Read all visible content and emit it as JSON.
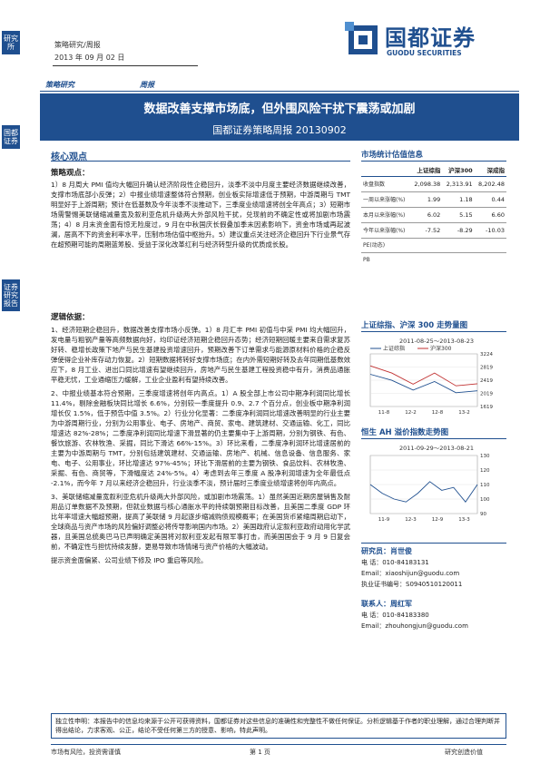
{
  "side": {
    "tab1": "研究所",
    "tab2": "证券研究报告",
    "tab3": "国都证券"
  },
  "header": {
    "line1": "策略研究/周报",
    "line2": "2013 年 09 月 02 日",
    "logo_cn": "国都证券",
    "logo_en": "GUODU SECURITIES"
  },
  "category": {
    "a": "策略研究",
    "b": "周报"
  },
  "title": {
    "main": "数据改善支撑市场底，但外围风险干扰下震荡或加剧",
    "sub": "国都证券策略周报 20130902"
  },
  "core": {
    "heading": "核心观点",
    "view_label": "策略观点：",
    "view_text": "1）8 月周大 PMI 值均大幅回升确认经济阶段性企稳回升，淡季不淡中月度主要经济数据继续改善，支撑市场底部小反弹；2）中报业绩增速整体符合预期，创业板实际增速低于预期，中游周期与 TMT 明显好于上游周期；预计在低基数及今年淡季不淡推动下，三季度业绩增速将创全年高点；3）短期市场需警惕美联储缩减量宽及叙利亚危机升级两大外部风险干扰，兑现前的不确定性或将加剧市场震荡；4）8 月末资金面有惊无险度过，9 月在中秋国庆长假叠加季末因素影响下，资金市场或再起波澜，居高不下的资金利率水平，压制市场估值中枢抬升。5）建议重点关注经济企稳回升下行业景气存在超预期可能的周期蓝筹股、受益于深化改革红利与经济转型升级的优质成长股。",
    "logic_label": "逻辑依据：",
    "p1": "1、经济短期企稳回升，数据改善支撑市场小反弹。1）8 月汇丰 PMI 初值与中采 PMI 均大幅回升，发电量与粗钢产量等高频数据向好，均印证经济短期企稳回升态势；经济短期回暖主要来自需求复苏好转、稳增长政策下地产与民生基建投资增速回升，预期改善下订单需求与能源原材料价格的企稳反弹使得企业补库存动力恢复。2）短期数据将转好支撑市场底；在内外需短期好转及去年同期低基数效应下，8 月工业、进出口同比增速有望继续回升，房地产与民生基建工程投资稳中有升，消费品通胀平稳无忧，工业通缩压力缓解，工业企业盈利有望持续改善。",
    "p2": "2、中报业绩基本符合预期，三季度增速将创年内高点。1）A 股全部上市公司中期净利润同比增长 11.4%，剔除金融板块同比增长 6.6%，分别较一季度提升 0.9、2.7 个百分点，创业板中期净利润增长仅 1.5%，低于预告中值 3.5%。2）行业分化显著：二季度净利润同比增速改善明显的行业主要为中游周期行业，分别为公用事业、电子、房地产、商贸、家电、建筑建材、交通运输、化工，同比增速达 82%-28%；二季度净利润同比增速下滑显著的仍主要集中于上游周期，分别为钢铁、有色、餐饮旅游、农林牧渔、采掘，同比下滑达 66%-15%。3）环比来看，二季度净利润环比增速居前的主要为中游周期与 TMT，分别包括建筑建材、交通运输、房地产、机械、信息设备、信息服务、家电、电子、公用事业，环比增速达 97%-45%；环比下滑居前的主要为钢铁、食品饮料、农林牧渔、采掘、有色、商贸等，下滑幅度达 24%-5%。4）考虑到去年三季度 A 股净利润增速为全年最低点 -2.1%，而今年 7 月以来经济企稳回升，行业淡季不淡，预计届时三季度业绩增速将创年内高点。",
    "p3": "3、美联储缩减量宽叙利亚危机升级两大外部风险，或加剧市场震荡。1）虽然美国近期房屋销售及耐用品订单数据不及预期，但就业数据与核心通胀水平的持续朝预期目标改善，且美国二季度 GDP 环比年率增速大幅超预期，提高了美联储 9 月起逐步缩减购债规模概率；在美国货币紧缩周期启动下，全球商品与资产市场的风险偏好调整必将传导影响国内市场。2）美国政府认定叙利亚政府动用化学武器，且美国总统奥巴马已声明确定美国将对叙利亚发起有限军事打击，而美国国会于 9 月 9 日复会前，不确定性与担忧持续发酵，更易导致市场情绪与资产价格的大幅波动。",
    "p4": "提示资金面偏紧、公司业绩下修及 IPO 重启等风险。"
  },
  "stats": {
    "heading": "市场统计估值信息",
    "columns": [
      "",
      "上证综指",
      "沪深300",
      "深成指"
    ],
    "rows": [
      {
        "label": "收盘指数",
        "values": [
          "2,098.38",
          "2,313.91",
          "8,202.48"
        ]
      },
      {
        "label": "一周以来涨幅(%)",
        "values": [
          "1.99",
          "1.18",
          "0.44"
        ]
      },
      {
        "label": "本月以来涨幅(%)",
        "values": [
          "6.02",
          "5.15",
          "6.60"
        ]
      },
      {
        "label": "今年以来涨幅(%)",
        "values": [
          "-7.52",
          "-8.29",
          "-10.03"
        ]
      },
      {
        "label": "PE(动态)",
        "values": [
          "",
          "",
          ""
        ]
      },
      {
        "label": "PB",
        "values": [
          "",
          "",
          ""
        ]
      }
    ]
  },
  "chart1": {
    "heading": "上证综指、沪深 300 走势量图",
    "date_range": "2011-08-25～2013-08-23",
    "legend": [
      "上证综指",
      "沪深300"
    ],
    "y_ticks": [
      "3224",
      "2819",
      "2419",
      "2019",
      "1619"
    ],
    "x_ticks": [
      "11-8",
      "12-2",
      "12-8",
      "13-2"
    ]
  },
  "chart2": {
    "heading": "恒生 AH 溢价指数走势图",
    "date_range": "2011-09-29～2013-08-21",
    "y_ticks": [
      "130",
      "120",
      "110",
      "100",
      "90"
    ],
    "x_ticks": [
      "11-9",
      "12-3",
      "12-9",
      "13-3"
    ]
  },
  "chart_data": [
    {
      "type": "line",
      "title": "上证综指、沪深 300 走势量图",
      "x": [
        "11-8",
        "12-2",
        "12-8",
        "13-2"
      ],
      "series": [
        {
          "name": "上证综指",
          "values": [
            2600,
            2420,
            2120,
            2380,
            2040,
            2098
          ]
        },
        {
          "name": "沪深300",
          "values": [
            2860,
            2640,
            2300,
            2640,
            2250,
            2314
          ]
        }
      ],
      "ylim": [
        1619,
        3224
      ]
    },
    {
      "type": "line",
      "title": "恒生 AH 溢价指数走势图",
      "x": [
        "11-9",
        "12-3",
        "12-9",
        "13-3"
      ],
      "series": [
        {
          "values": [
            110,
            104,
            100,
            98,
            104,
            112,
            106,
            108,
            98,
            110
          ]
        }
      ],
      "ylim": [
        90,
        130
      ]
    }
  ],
  "analysts": {
    "a1_title": "研究员：肖世俊",
    "a1_tel": "电 话：010-84183131",
    "a1_email": "Email：xiaoshijun@guodu.com",
    "a1_cert": "执业证书编号：S0940510120011",
    "a2_title": "联系人：周红军",
    "a2_tel": "电 话：010-84183380",
    "a2_email": "Email：zhouhongjun@guodu.com"
  },
  "footer": {
    "disclaimer": "独立性申明：本报告中的信息均来源于公开可获得资料，国都证券对这些信息的准确性和完整性不做任何保证。分析逻辑基于作者的职业理解，通过合理判断并得出结论，力求客观、公正，结论不受任何第三方的授意、影响，特此声明。",
    "left": "市场有风险，投资需谨慎",
    "center": "第 1 页",
    "right": "研究创造价值"
  }
}
